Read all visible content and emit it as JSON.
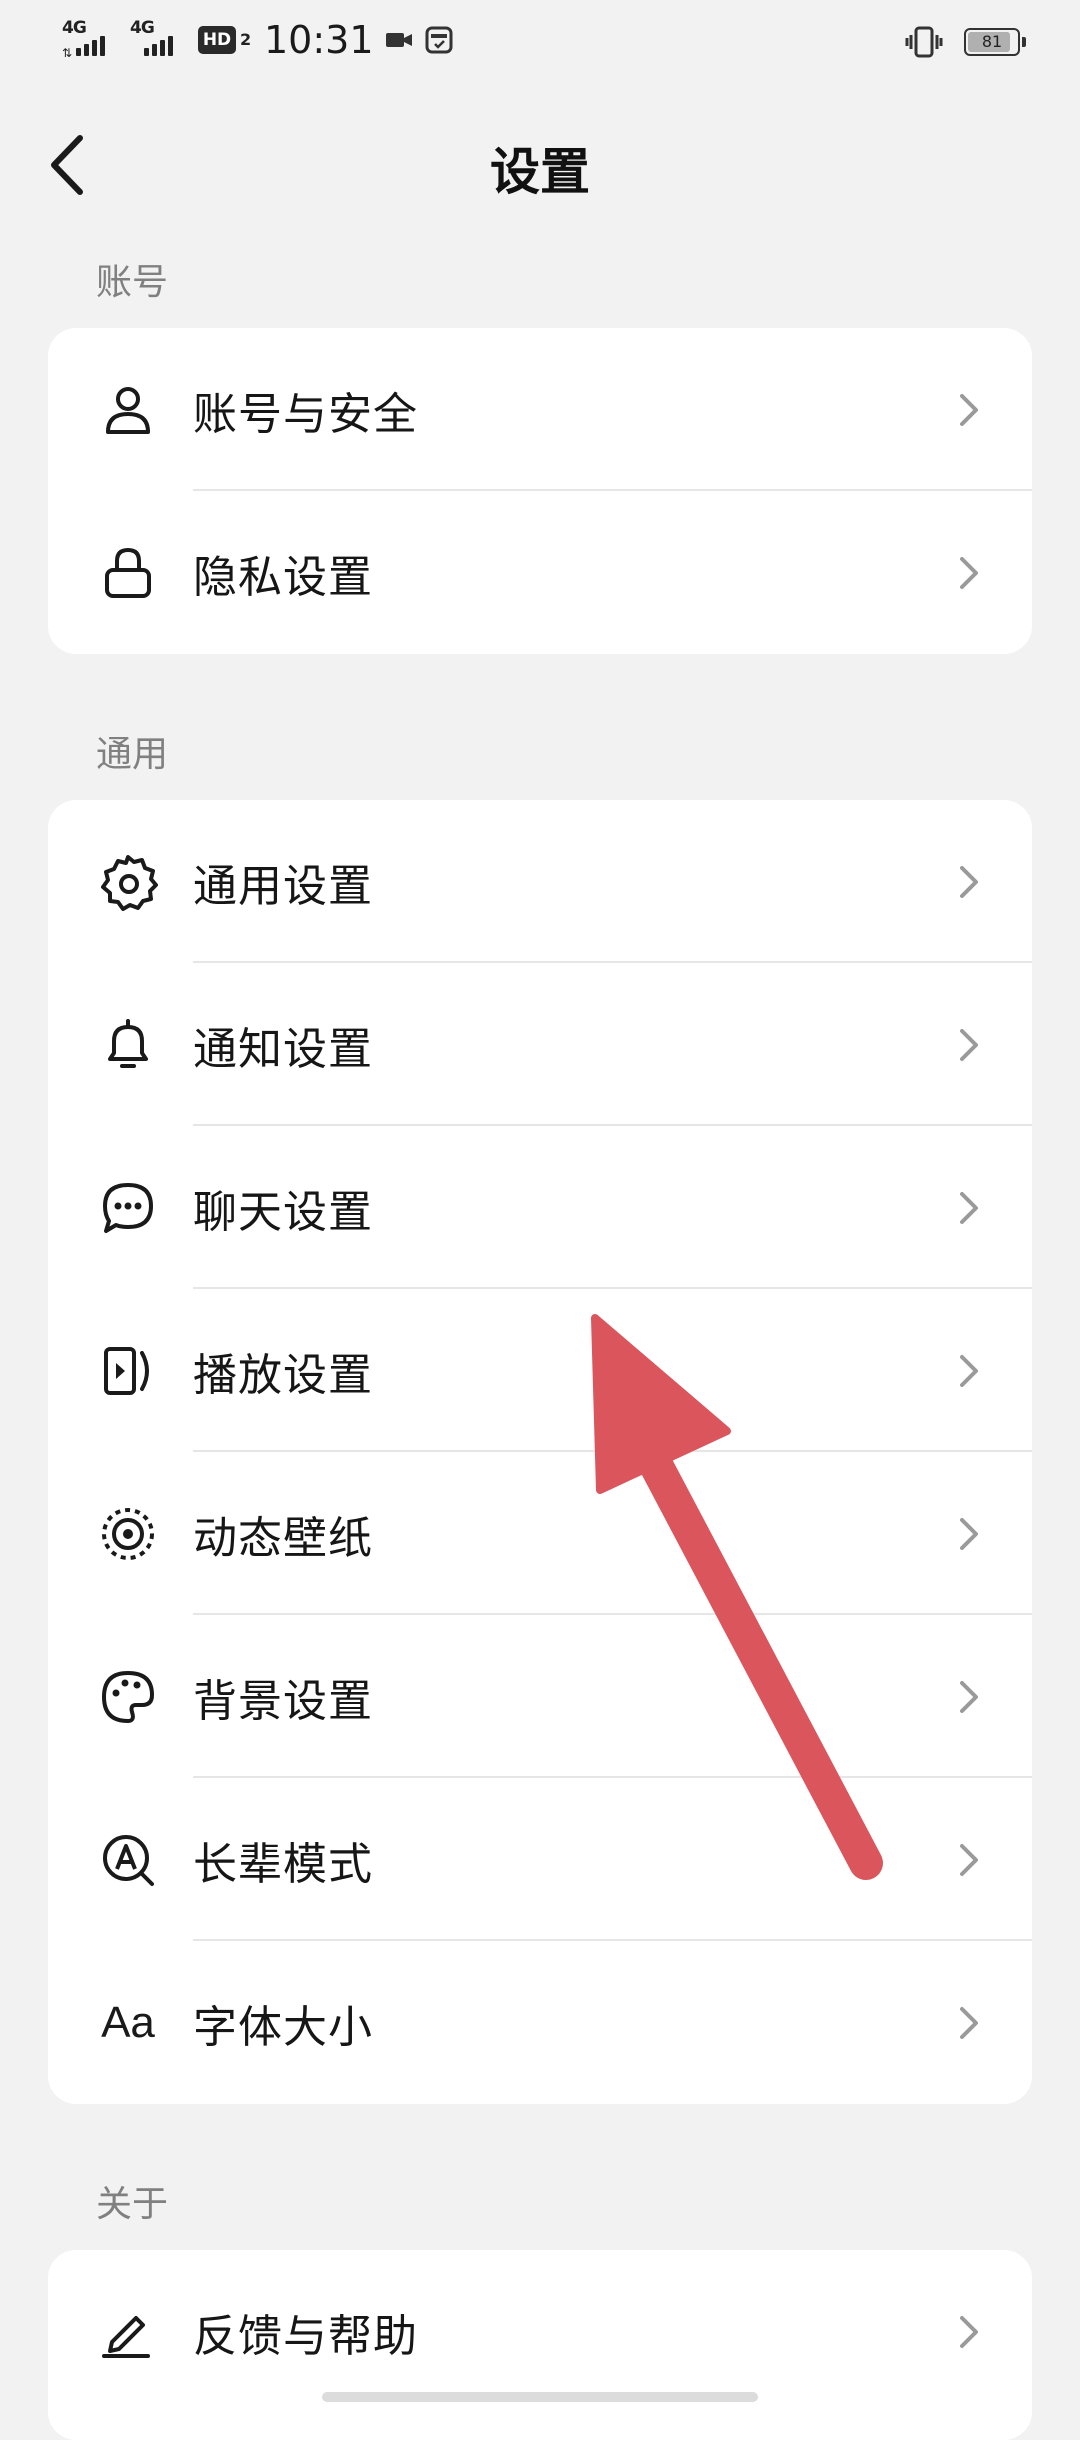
{
  "status_bar": {
    "sim1_network": "4G",
    "sim2_network": "4G",
    "hd_badge": "HD",
    "hd_sub": "2",
    "time": "10:31",
    "battery_level": "81",
    "icons": [
      "video-camera-icon",
      "card-notification-icon",
      "vibrate-icon",
      "battery-icon"
    ]
  },
  "nav": {
    "title": "设置",
    "back_icon": "chevron-left-icon"
  },
  "sections": {
    "account": {
      "label": "账号",
      "items": [
        {
          "label": "账号与安全",
          "icon": "user-icon"
        },
        {
          "label": "隐私设置",
          "icon": "lock-icon"
        }
      ]
    },
    "general": {
      "label": "通用",
      "items": [
        {
          "label": "通用设置",
          "icon": "gear-icon"
        },
        {
          "label": "通知设置",
          "icon": "bell-icon"
        },
        {
          "label": "聊天设置",
          "icon": "chat-bubble-icon"
        },
        {
          "label": "播放设置",
          "icon": "play-screen-icon"
        },
        {
          "label": "动态壁纸",
          "icon": "live-wallpaper-icon"
        },
        {
          "label": "背景设置",
          "icon": "palette-icon"
        },
        {
          "label": "长辈模式",
          "icon": "elder-mode-icon"
        },
        {
          "label": "字体大小",
          "icon": "font-size-icon",
          "icon_text": "Aa"
        }
      ]
    },
    "about": {
      "label": "关于",
      "items": [
        {
          "label": "反馈与帮助",
          "icon": "pencil-icon"
        }
      ]
    }
  },
  "colors": {
    "background": "#f2f2f2",
    "card": "#ffffff",
    "annotation_arrow": "#db555d",
    "section_label": "#808080"
  }
}
